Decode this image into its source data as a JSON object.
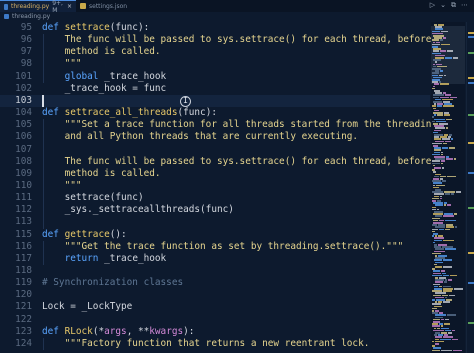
{
  "tabs": [
    {
      "label": "threading.py",
      "meta": "9+, M",
      "active": true,
      "icon": "python-file-icon"
    },
    {
      "label": "settings.json",
      "meta": "",
      "active": false,
      "icon": "json-file-icon"
    }
  ],
  "breadcrumb": {
    "file": "threading.py"
  },
  "tab_actions": [
    "▷",
    "⌄",
    "⧉",
    "⋯"
  ],
  "cursor_line": 103,
  "colors": {
    "background": "#0d1a2e",
    "keyword": "#5aa5ff",
    "function": "#e8c96a",
    "string": "#e6d58f",
    "comment": "#5f7794",
    "line_number": "#5a6a80"
  },
  "lines": [
    {
      "n": "95",
      "tokens": [
        [
          "kw",
          "def "
        ],
        [
          "fn",
          "settrace"
        ],
        [
          "plain",
          "(func):"
        ]
      ]
    },
    {
      "n": "96",
      "tokens": [
        [
          "str",
          "    The func will be passed to sys.settrace() for each thread, before its run()"
        ]
      ]
    },
    {
      "n": "97",
      "tokens": [
        [
          "str",
          "    method is called."
        ]
      ]
    },
    {
      "n": "98",
      "tokens": [
        [
          "str",
          "    \"\"\""
        ]
      ]
    },
    {
      "n": "101",
      "tokens": [
        [
          "kw",
          "    global "
        ],
        [
          "plain",
          "_trace_hook"
        ]
      ]
    },
    {
      "n": "102",
      "tokens": [
        [
          "plain",
          "    _trace_hook = func"
        ]
      ]
    },
    {
      "n": "103",
      "tokens": [
        [
          "plain",
          ""
        ]
      ]
    },
    {
      "n": "104",
      "tokens": [
        [
          "kw",
          "def "
        ],
        [
          "fn",
          "settrace_all_threads"
        ],
        [
          "plain",
          "(func):"
        ]
      ]
    },
    {
      "n": "105",
      "tokens": [
        [
          "str",
          "    \"\"\"Set a trace function for all threads started from the threading module"
        ]
      ]
    },
    {
      "n": "106",
      "tokens": [
        [
          "str",
          "    and all Python threads that are currently executing."
        ]
      ]
    },
    {
      "n": "107",
      "tokens": [
        [
          "str",
          ""
        ]
      ]
    },
    {
      "n": "108",
      "tokens": [
        [
          "str",
          "    The func will be passed to sys.settrace() for each thread, before its run()"
        ]
      ]
    },
    {
      "n": "109",
      "tokens": [
        [
          "str",
          "    method is called."
        ]
      ]
    },
    {
      "n": "110",
      "tokens": [
        [
          "str",
          "    \"\"\""
        ]
      ]
    },
    {
      "n": "111",
      "tokens": [
        [
          "plain",
          "    settrace(func)"
        ]
      ]
    },
    {
      "n": "112",
      "tokens": [
        [
          "plain",
          "    _sys._settraceallthreads(func)"
        ]
      ]
    },
    {
      "n": "113",
      "tokens": [
        [
          "plain",
          ""
        ]
      ]
    },
    {
      "n": "115",
      "tokens": [
        [
          "kw",
          "def "
        ],
        [
          "fn",
          "gettrace"
        ],
        [
          "plain",
          "():"
        ]
      ]
    },
    {
      "n": "116",
      "tokens": [
        [
          "str",
          "    \"\"\"Get the trace function as set by threading.settrace().\"\"\""
        ]
      ]
    },
    {
      "n": "117",
      "tokens": [
        [
          "kw",
          "    return "
        ],
        [
          "plain",
          "_trace_hook"
        ]
      ]
    },
    {
      "n": "118",
      "tokens": [
        [
          "plain",
          ""
        ]
      ]
    },
    {
      "n": "119",
      "tokens": [
        [
          "cm",
          "# Synchronization classes"
        ]
      ]
    },
    {
      "n": "120",
      "tokens": [
        [
          "plain",
          ""
        ]
      ]
    },
    {
      "n": "121",
      "tokens": [
        [
          "plain",
          "Lock = _LockType"
        ]
      ]
    },
    {
      "n": "122",
      "tokens": [
        [
          "plain",
          ""
        ]
      ]
    },
    {
      "n": "123",
      "tokens": [
        [
          "kw",
          "def "
        ],
        [
          "fn",
          "RLock"
        ],
        [
          "plain",
          "(*"
        ],
        [
          "param",
          "args"
        ],
        [
          "plain",
          ", **"
        ],
        [
          "param",
          "kwargs"
        ],
        [
          "plain",
          "):"
        ]
      ]
    },
    {
      "n": "124",
      "tokens": [
        [
          "str",
          "    \"\"\"Factory function that returns a new reentrant lock."
        ]
      ]
    }
  ]
}
